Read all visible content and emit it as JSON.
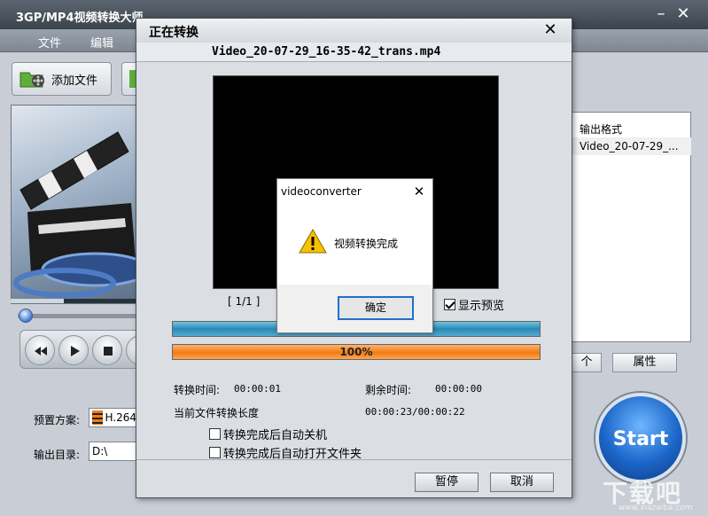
{
  "main": {
    "title": "3GP/MP4视频转换大师",
    "menu": [
      "文件",
      "编辑"
    ],
    "toolbar": {
      "add_file": "添加文件"
    },
    "output_list": {
      "column_header": "输出格式",
      "rows": [
        "Video_20-07-29_..."
      ]
    },
    "buttons": {
      "partial_left": "个",
      "properties": "属性"
    },
    "preset_label": "预置方案:",
    "preset_value": "H.264",
    "output_dir_label": "输出目录:",
    "output_dir_value": "D:\\",
    "start": "Start",
    "watermark": "下载吧",
    "watermark_url": "www.xiazaiba.com"
  },
  "conversion": {
    "title": "正在转换",
    "filename": "Video_20-07-29_16-35-42_trans.mp4",
    "page_count": "[ 1/1 ]",
    "show_preview": "显示预览",
    "show_preview_checked": true,
    "progress_percent": 100,
    "progress_label": "100%",
    "convert_time_label": "转换时间:",
    "convert_time": "00:00:01",
    "remaining_label": "剩余时间:",
    "remaining": "00:00:00",
    "length_label": "当前文件转换长度",
    "length": "00:00:23/00:00:22",
    "option_shutdown": "转换完成后自动关机",
    "option_open_folder": "转换完成后自动打开文件夹",
    "pause": "暂停",
    "cancel": "取消"
  },
  "msgbox": {
    "title": "videoconverter",
    "message": "视频转换完成",
    "ok": "确定"
  },
  "colors": {
    "accent_blue": "#2a89b6",
    "progress_orange": "#f07c14",
    "start_blue": "#1b66c9",
    "warning_yellow": "#f7c000"
  }
}
